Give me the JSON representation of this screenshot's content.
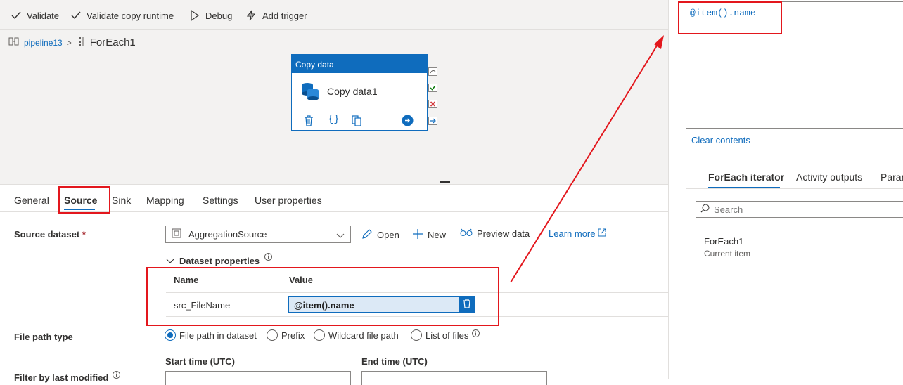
{
  "toolbar": {
    "validate": "Validate",
    "validate_copy_runtime": "Validate copy runtime",
    "debug": "Debug",
    "add_trigger": "Add trigger"
  },
  "breadcrumb": {
    "pipeline": "pipeline13",
    "separator": ">",
    "current": "ForEach1"
  },
  "activity": {
    "header": "Copy data",
    "name": "Copy data1"
  },
  "tabs": {
    "general": "General",
    "source": "Source",
    "sink": "Sink",
    "mapping": "Mapping",
    "settings": "Settings",
    "user_properties": "User properties"
  },
  "source": {
    "dataset_label": "Source dataset",
    "required_mark": "*",
    "dataset_value": "AggregationSource",
    "open": "Open",
    "new": "New",
    "preview": "Preview data",
    "learn_more": "Learn more",
    "dataset_properties": "Dataset properties",
    "table": {
      "columns": [
        "Name",
        "Value"
      ],
      "rows": [
        {
          "name": "src_FileName",
          "value": "@item().name"
        }
      ]
    },
    "file_path_type_label": "File path type",
    "file_path_options": [
      "File path in dataset",
      "Prefix",
      "Wildcard file path",
      "List of files"
    ],
    "selected_option": "File path in dataset",
    "start_time": "Start time (UTC)",
    "end_time": "End time (UTC)",
    "filter_label": "Filter by last modified"
  },
  "expression": {
    "value": "@item().name",
    "clear_contents": "Clear contents"
  },
  "right_tabs": {
    "foreach_iterator": "ForEach iterator",
    "activity_outputs": "Activity outputs",
    "params": "Param"
  },
  "search": {
    "placeholder": "Search"
  },
  "iterator_item": {
    "title": "ForEach1",
    "subtitle": "Current item"
  },
  "colors": {
    "accent": "#0f6cbd",
    "annotation": "#e3171d",
    "error": "#d13438",
    "success": "#107c10"
  }
}
